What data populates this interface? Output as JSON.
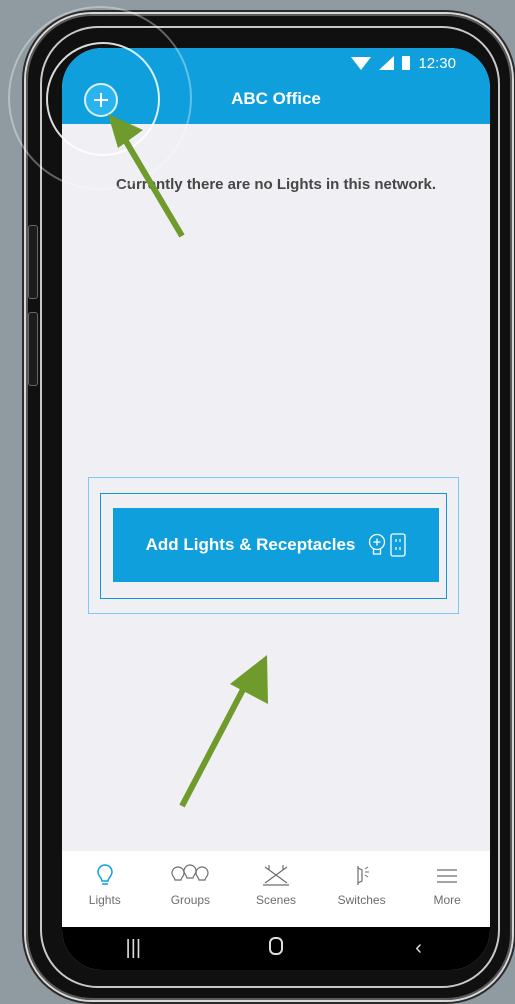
{
  "status_bar": {
    "time": "12:30"
  },
  "header": {
    "title": "ABC Office"
  },
  "main": {
    "empty_message": "Currently there are no Lights in this network.",
    "cta_label": "Add Lights & Receptacles"
  },
  "bottom_nav": {
    "items": [
      {
        "label": "Lights",
        "icon": "bulb-icon",
        "active": true
      },
      {
        "label": "Groups",
        "icon": "bulbs-group-icon",
        "active": false
      },
      {
        "label": "Scenes",
        "icon": "scene-icon",
        "active": false
      },
      {
        "label": "Switches",
        "icon": "switch-icon",
        "active": false
      },
      {
        "label": "More",
        "icon": "menu-lines-icon",
        "active": false
      }
    ]
  },
  "system_nav": {
    "recents": "recents-icon",
    "home": "home-icon",
    "back": "back-icon"
  },
  "colors": {
    "accent": "#0f9fdc",
    "active_icon": "#0f9fdc",
    "inactive": "#6d6d6d",
    "arrow": "#6f9a2c"
  }
}
